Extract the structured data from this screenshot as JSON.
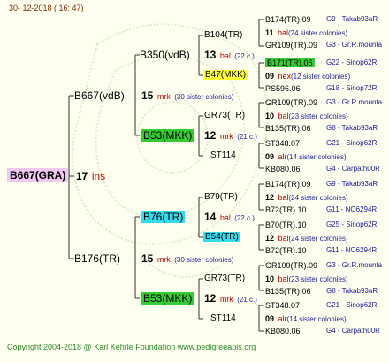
{
  "header": {
    "date": "30- 12-2018 ( 16: 47)"
  },
  "footer": {
    "copyright": "Copyright 2004-2018 @ Karl Kehrle Foundation    www.pedigreeapis.org"
  },
  "root": {
    "name": "B667(GRA)",
    "num": "17",
    "type": "ins"
  },
  "level1": [
    {
      "name": "B667(vdB)",
      "num": "15",
      "type": "mrk",
      "sisters": "(30 sister colonies)"
    },
    {
      "name": "B176(TR)",
      "num": "15",
      "type": "mrk",
      "sisters": "(30 sister colonies)"
    }
  ],
  "level2": [
    {
      "name": "B350(vdB)",
      "num": "13",
      "type": "bal",
      "sisters": "(22 c.)"
    },
    {
      "name": "B53(MKK)",
      "num": "12",
      "type": "mrk",
      "sisters": "(21 c.)"
    },
    {
      "name": "B76(TR)",
      "num": "14",
      "type": "bal",
      "sisters": "(22 c.)"
    },
    {
      "name": "B53(MKK)",
      "num": "12",
      "type": "mrk",
      "sisters": "(21 c.)"
    }
  ],
  "level3": [
    {
      "name": "B104(TR)"
    },
    {
      "name": "B47(MKK)"
    },
    {
      "name": "GR73(TR)"
    },
    {
      "name": "ST114"
    },
    {
      "name": "B79(TR)"
    },
    {
      "name": "B54(TR)"
    },
    {
      "name": "GR73(TR)"
    },
    {
      "name": "ST114"
    }
  ],
  "level4": [
    {
      "top": "B174(TR).09",
      "topcode": "G9 - Takab93aR",
      "num": "11",
      "type": "bal",
      "sisters": "(24 sister colonies)",
      "bot": "GR109(TR).09",
      "botcode": "G3 - Gr.R.mounta"
    },
    {
      "top": "B171(TR).06",
      "topcode": "G22 - Sinop62R",
      "num": "09",
      "type": "nex",
      "sisters": "(12 sister colonies)",
      "bot": "PS596.06",
      "botcode": "G18 - Sinop72R"
    },
    {
      "top": "GR109(TR).09",
      "topcode": "G3 - Gr.R.mounta",
      "num": "10",
      "type": "bal",
      "sisters": "(23 sister colonies)",
      "bot": "B135(TR).06",
      "botcode": "G8 - Takab93aR"
    },
    {
      "top": "ST348.07",
      "topcode": "G21 - Sinop62R",
      "num": "09",
      "type": "alr",
      "sisters": "(14 sister colonies)",
      "bot": "KB080.06",
      "botcode": "G4 - Carpath00R"
    },
    {
      "top": "B174(TR).09",
      "topcode": "G9 - Takab93aR",
      "num": "12",
      "type": "bal",
      "sisters": "(24 sister colonies)",
      "bot": "B72(TR).10",
      "botcode": "G11 - NO6294R"
    },
    {
      "top": "B70(TR).10",
      "topcode": "G25 - Sinop62R",
      "num": "12",
      "type": "bal",
      "sisters": "(24 sister colonies)",
      "bot": "B72(TR).10",
      "botcode": "G11 - NO6294R"
    },
    {
      "top": "GR109(TR).09",
      "topcode": "G3 - Gr.R.mounta",
      "num": "10",
      "type": "bal",
      "sisters": "(23 sister colonies)",
      "bot": "B135(TR).06",
      "botcode": "G8 - Takab93aR"
    },
    {
      "top": "ST348.07",
      "topcode": "G21 - Sinop62R",
      "num": "09",
      "type": "alr",
      "sisters": "(14 sister colonies)",
      "bot": "KB080.06",
      "botcode": "G4 - Carpath00R"
    }
  ],
  "colors": {
    "line": "#333333",
    "green": "#33cc33",
    "yellow": "#ffff33",
    "cyan": "#33ddee",
    "pink": "#f0c8f0",
    "red": "#c00000",
    "blue": "#1a1aa0"
  }
}
